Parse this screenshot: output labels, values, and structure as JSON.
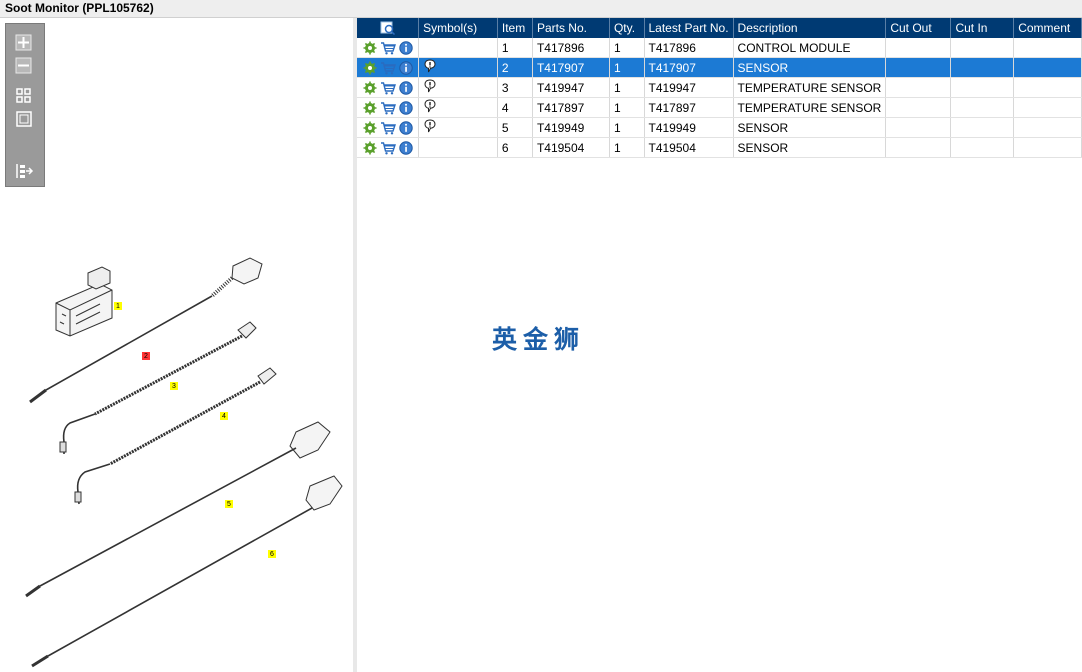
{
  "window": {
    "title": "Soot Monitor (PPL105762)"
  },
  "toolbar": {
    "buttons": [
      {
        "name": "zoom-in-button",
        "icon": "zoom-in-icon"
      },
      {
        "name": "zoom-out-button",
        "icon": "zoom-out-icon"
      },
      {
        "name": "fit-all-button",
        "icon": "fit-all-icon"
      },
      {
        "name": "fit-window-button",
        "icon": "fit-window-icon"
      },
      {
        "name": "panel-toggle-button",
        "icon": "panel-toggle-icon"
      }
    ]
  },
  "grid": {
    "columns": {
      "icons": "",
      "symbols": "Symbol(s)",
      "item": "Item",
      "parts_no": "Parts No.",
      "qty": "Qty.",
      "latest_part_no": "Latest Part No.",
      "description": "Description",
      "cut_out": "Cut Out",
      "cut_in": "Cut In",
      "comment": "Comment"
    },
    "rows": [
      {
        "item": "1",
        "parts_no": "T417896",
        "qty": "1",
        "latest_part_no": "T417896",
        "description": "CONTROL MODULE",
        "symbol": "",
        "cut_out": "",
        "cut_in": "",
        "comment": ""
      },
      {
        "item": "2",
        "parts_no": "T417907",
        "qty": "1",
        "latest_part_no": "T417907",
        "description": "SENSOR",
        "symbol": "note-pin-icon",
        "cut_out": "",
        "cut_in": "",
        "comment": ""
      },
      {
        "item": "3",
        "parts_no": "T419947",
        "qty": "1",
        "latest_part_no": "T419947",
        "description": "TEMPERATURE SENSOR",
        "symbol": "note-pin-icon",
        "cut_out": "",
        "cut_in": "",
        "comment": ""
      },
      {
        "item": "4",
        "parts_no": "T417897",
        "qty": "1",
        "latest_part_no": "T417897",
        "description": "TEMPERATURE SENSOR",
        "symbol": "note-pin-icon",
        "cut_out": "",
        "cut_in": "",
        "comment": ""
      },
      {
        "item": "5",
        "parts_no": "T419949",
        "qty": "1",
        "latest_part_no": "T419949",
        "description": "SENSOR",
        "symbol": "note-pin-icon",
        "cut_out": "",
        "cut_in": "",
        "comment": ""
      },
      {
        "item": "6",
        "parts_no": "T419504",
        "qty": "1",
        "latest_part_no": "T419504",
        "description": "SENSOR",
        "symbol": "",
        "cut_out": "",
        "cut_in": "",
        "comment": ""
      }
    ],
    "selected_row": "2"
  },
  "drawing": {
    "callouts": [
      "1",
      "2",
      "3",
      "4",
      "5",
      "6"
    ],
    "callout_color": "#ffff00",
    "selected_callout_color": "#ff3333"
  },
  "watermark": {
    "text": "英金狮"
  },
  "colors": {
    "header_bg": "#003a73",
    "selected_row_bg": "#1c7ad4"
  }
}
